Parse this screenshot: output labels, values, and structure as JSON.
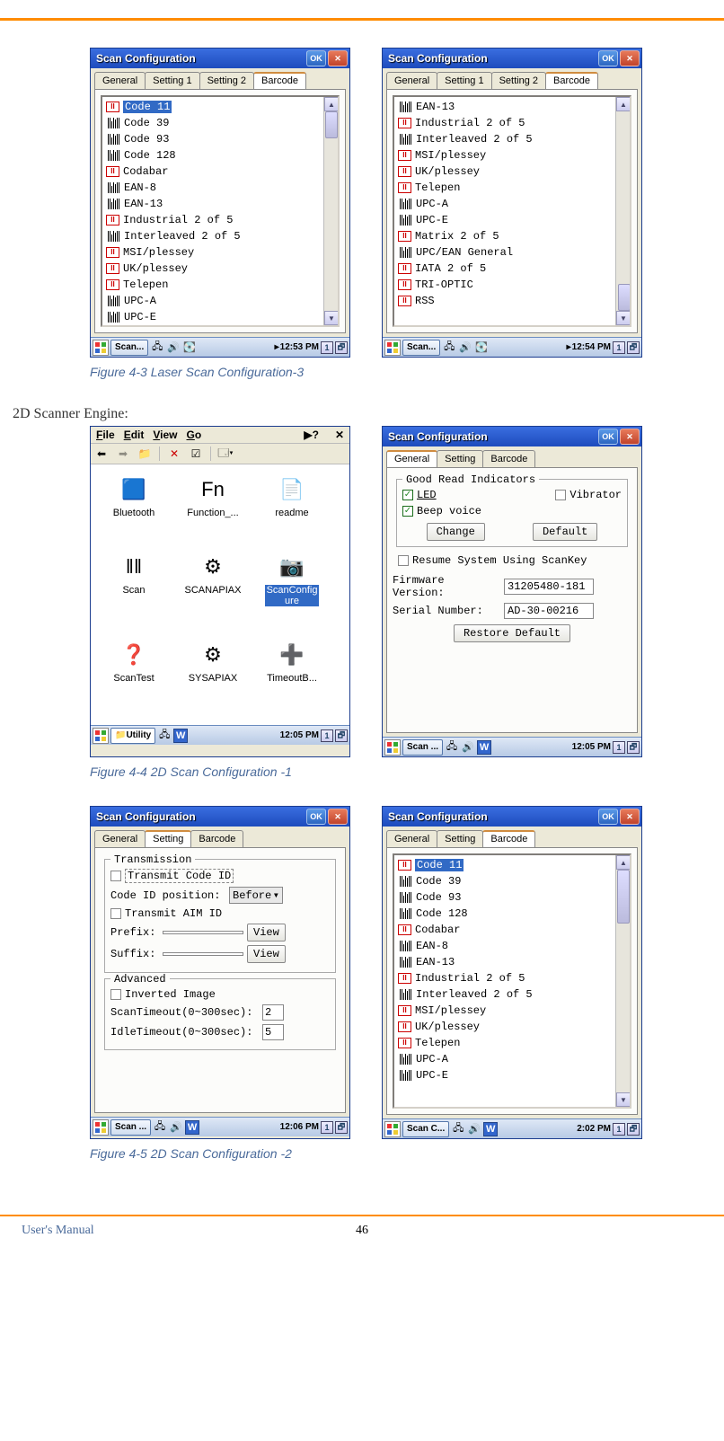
{
  "top_caption_1": "Figure 4-3 Laser Scan Configuration-3",
  "section_2d": "2D Scanner Engine:",
  "caption_44": "Figure 4-4 2D Scan Configuration  -1",
  "caption_45": "Figure 4-5 2D Scan Configuration -2",
  "footer_left": "User's Manual",
  "footer_center": "46",
  "win_title": "Scan Configuration",
  "ok": "OK",
  "tabs4": [
    "General",
    "Setting 1",
    "Setting 2",
    "Barcode"
  ],
  "tab_general": "General",
  "tab_setting": "Setting",
  "tab_barcode": "Barcode",
  "list_a": [
    {
      "t": "Code 11",
      "r": 1,
      "sel": 1
    },
    {
      "t": "Code 39",
      "r": 0
    },
    {
      "t": "Code 93",
      "r": 0
    },
    {
      "t": "Code 128",
      "r": 0
    },
    {
      "t": "Codabar",
      "r": 1
    },
    {
      "t": "EAN-8",
      "r": 0
    },
    {
      "t": "EAN-13",
      "r": 0
    },
    {
      "t": "Industrial 2 of 5",
      "r": 1
    },
    {
      "t": "Interleaved 2 of 5",
      "r": 0
    },
    {
      "t": "MSI/plessey",
      "r": 1
    },
    {
      "t": "UK/plessey",
      "r": 1
    },
    {
      "t": "Telepen",
      "r": 1
    },
    {
      "t": "UPC-A",
      "r": 0
    },
    {
      "t": "UPC-E",
      "r": 0
    }
  ],
  "list_b": [
    {
      "t": "EAN-13",
      "r": 0
    },
    {
      "t": "Industrial 2 of 5",
      "r": 1
    },
    {
      "t": "Interleaved 2 of 5",
      "r": 0
    },
    {
      "t": "MSI/plessey",
      "r": 1
    },
    {
      "t": "UK/plessey",
      "r": 1
    },
    {
      "t": "Telepen",
      "r": 1
    },
    {
      "t": "UPC-A",
      "r": 0
    },
    {
      "t": "UPC-E",
      "r": 0
    },
    {
      "t": "Matrix 2 of 5",
      "r": 1
    },
    {
      "t": "UPC/EAN General",
      "r": 0
    },
    {
      "t": "IATA 2 of 5",
      "r": 1
    },
    {
      "t": "TRI-OPTIC",
      "r": 1
    },
    {
      "t": "RSS",
      "r": 1
    }
  ],
  "list_c": [
    {
      "t": "Code 11",
      "r": 1,
      "sel": 1
    },
    {
      "t": "Code 39",
      "r": 0
    },
    {
      "t": "Code 93",
      "r": 0
    },
    {
      "t": "Code 128",
      "r": 0
    },
    {
      "t": "Codabar",
      "r": 1
    },
    {
      "t": "EAN-8",
      "r": 0
    },
    {
      "t": "EAN-13",
      "r": 0
    },
    {
      "t": "Industrial 2 of 5",
      "r": 1
    },
    {
      "t": "Interleaved 2 of 5",
      "r": 0
    },
    {
      "t": "MSI/plessey",
      "r": 1
    },
    {
      "t": "UK/plessey",
      "r": 1
    },
    {
      "t": "Telepen",
      "r": 1
    },
    {
      "t": "UPC-A",
      "r": 0
    },
    {
      "t": "UPC-E",
      "r": 0
    }
  ],
  "tb_scan": "Scan...",
  "tb_scan2": "Scan ...",
  "tb_scanc": "Scan C...",
  "tb_utility": "Utility",
  "time_1253": "12:53 PM",
  "time_1254": "12:54 PM",
  "time_1205": "12:05 PM",
  "time_1206": "12:06 PM",
  "time_202": "2:02 PM",
  "menu_items": [
    "File",
    "Edit",
    "View",
    "Go"
  ],
  "explorer_icons": [
    {
      "n": "Bluetooth"
    },
    {
      "n": "Function_..."
    },
    {
      "n": "readme"
    },
    {
      "n": "Scan"
    },
    {
      "n": "SCANAPIAX"
    },
    {
      "n": "ScanConfigure",
      "sel": 1
    },
    {
      "n": "ScanTest"
    },
    {
      "n": "SYSAPIAX"
    },
    {
      "n": "TimeoutB..."
    }
  ],
  "good_read": "Good Read Indicators",
  "led": "LED",
  "vibrator": "Vibrator",
  "beep": "Beep voice",
  "change": "Change",
  "default": "Default",
  "resume": "Resume System Using ScanKey",
  "fw_label": "Firmware Version:",
  "fw_val": "31205480-181",
  "sn_label": "Serial Number:",
  "sn_val": "AD-30-00216",
  "restore": "Restore Default",
  "transmission": "Transmission",
  "transmit_code": "Transmit Code ID",
  "code_id_pos": "Code ID position:",
  "before": "Before",
  "transmit_aim": "Transmit AIM ID",
  "prefix": "Prefix:",
  "suffix": "Suffix:",
  "view": "View",
  "advanced": "Advanced",
  "inverted": "Inverted Image",
  "scantimeout": "ScanTimeout(0~300sec):",
  "scantimeout_v": "2",
  "idletimeout": "IdleTimeout(0~300sec):",
  "idletimeout_v": "5"
}
